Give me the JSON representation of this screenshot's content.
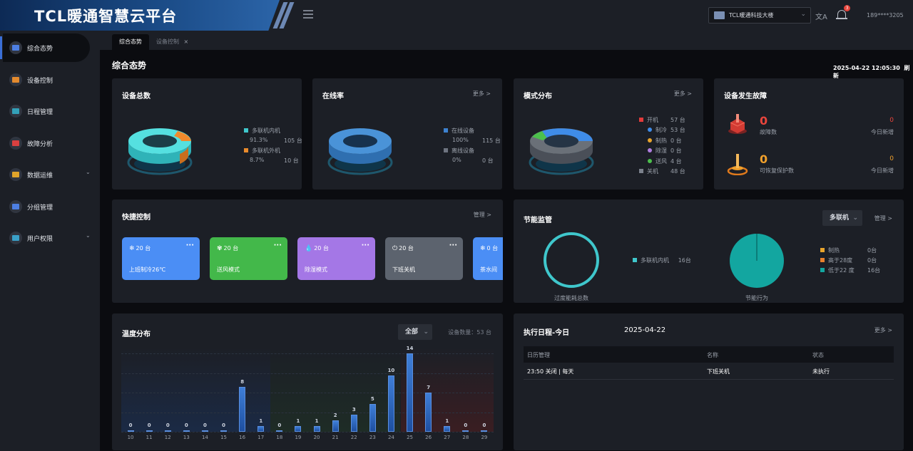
{
  "app": {
    "title": "TCL暖通智慧云平台",
    "building": "TCL暖通科技大楼",
    "notifications": "3",
    "user": "189****3205",
    "lang_icon": "translate-icon"
  },
  "sidebar": {
    "items": [
      {
        "label": "综合态势",
        "icon": "dashboard-icon",
        "color": "#4d7fe3"
      },
      {
        "label": "设备控制",
        "icon": "device-icon",
        "color": "#e38a2e"
      },
      {
        "label": "日程管理",
        "icon": "calendar-icon",
        "color": "#33a0b8"
      },
      {
        "label": "故障分析",
        "icon": "fault-icon",
        "color": "#d94040"
      },
      {
        "label": "数据运维",
        "icon": "data-icon",
        "color": "#e0a42a"
      },
      {
        "label": "分组管理",
        "icon": "group-icon",
        "color": "#4d7fe3"
      },
      {
        "label": "用户权限",
        "icon": "users-icon",
        "color": "#3aa0c8"
      }
    ]
  },
  "tabs": [
    {
      "label": "综合态势"
    },
    {
      "label": "设备控制",
      "close": "×"
    }
  ],
  "page": {
    "title": "综合态势",
    "datetime": "2025-04-22 12:05:30",
    "refresh": "刷新"
  },
  "device_total": {
    "title": "设备总数",
    "items": [
      {
        "label": "多联机内机",
        "pct": "91.3%",
        "count": "105 台",
        "color": "#3fc7cc"
      },
      {
        "label": "多联机外机",
        "pct": "8.7%",
        "count": "10 台",
        "color": "#e88a2c"
      }
    ]
  },
  "online": {
    "title": "在线率",
    "more": "更多 >",
    "items": [
      {
        "label": "在线设备",
        "pct": "100%",
        "count": "115 台",
        "color": "#3d82d0"
      },
      {
        "label": "离线设备",
        "pct": "0%",
        "count": "0 台",
        "color": "#6e7480"
      }
    ]
  },
  "mode": {
    "title": "模式分布",
    "more": "更多 >",
    "items": [
      {
        "label": "开机",
        "count": "57 台",
        "color": "#e23b3b",
        "square": true
      },
      {
        "label": "制冷",
        "count": "53 台",
        "color": "#3f8ce8"
      },
      {
        "label": "制热",
        "count": "0 台",
        "color": "#e8a42c"
      },
      {
        "label": "除湿",
        "count": "0 台",
        "color": "#b07ee0"
      },
      {
        "label": "送风",
        "count": "4 台",
        "color": "#4cc04c"
      },
      {
        "label": "关机",
        "count": "48 台",
        "color": "#7b818c",
        "square": true
      }
    ]
  },
  "fault": {
    "title": "设备发生故障",
    "rows": [
      {
        "value": "0",
        "label": "故障数",
        "today": "0",
        "today_label": "今日新增",
        "color": "#e8453c"
      },
      {
        "value": "0",
        "label": "可恢复保护数",
        "today": "0",
        "today_label": "今日新增",
        "color": "#f0a02c"
      }
    ]
  },
  "quick": {
    "title": "快捷控制",
    "manage": "管理 >",
    "items": [
      {
        "count": "20 台",
        "label": "上班制冷26℃",
        "color": "#4b8ef5",
        "icon": "snowflake-icon",
        "glyph": "❄"
      },
      {
        "count": "20 台",
        "label": "送风模式",
        "color": "#43b84a",
        "icon": "fan-icon",
        "glyph": "✾"
      },
      {
        "count": "20 台",
        "label": "除湿模式",
        "color": "#a477e6",
        "icon": "droplet-icon",
        "glyph": "💧"
      },
      {
        "count": "20 台",
        "label": "下班关机",
        "color": "#5c636e",
        "icon": "power-icon",
        "glyph": "⏻"
      },
      {
        "count": "0 台",
        "label": "茶水间",
        "color": "#4b8ef5",
        "icon": "snowflake-icon",
        "glyph": "❄"
      }
    ],
    "dots": "···"
  },
  "energy": {
    "title": "节能监管",
    "select": "多联机",
    "manage": "管理 >",
    "ring_label": "过度能耗总数",
    "pie_label": "节能行为",
    "ring_legend": {
      "label": "多联机内机",
      "count": "16台",
      "color": "#3fc7cc"
    },
    "pie_legend": [
      {
        "label": "制热",
        "count": "0台",
        "color": "#e8a42c"
      },
      {
        "label": "高于28度",
        "count": "0台",
        "color": "#e8802c"
      },
      {
        "label": "低于22 度",
        "count": "16台",
        "color": "#13a6a0"
      }
    ]
  },
  "temp": {
    "title": "温度分布",
    "select": "全部",
    "device_count": "设备数量：53 台"
  },
  "chart_data": {
    "type": "bar",
    "title": "温度分布",
    "categories": [
      "10",
      "11",
      "12",
      "13",
      "14",
      "15",
      "16",
      "17",
      "18",
      "19",
      "20",
      "21",
      "22",
      "23",
      "24",
      "25",
      "26",
      "27",
      "28",
      "29"
    ],
    "values": [
      0,
      0,
      0,
      0,
      0,
      0,
      8,
      1,
      0,
      1,
      1,
      2,
      3,
      5,
      10,
      14,
      7,
      1,
      0,
      0
    ],
    "ylim": [
      0,
      14
    ],
    "zones": [
      {
        "from": "10",
        "to": "17",
        "color": "#1b2a45"
      },
      {
        "from": "18",
        "to": "24",
        "color": "#1e2c26"
      },
      {
        "from": "25",
        "to": "29",
        "color": "#3a1e22"
      }
    ]
  },
  "schedule": {
    "title": "执行日程-今日",
    "date": "2025-04-22",
    "more": "更多 >",
    "headers": [
      "日历管理",
      "名称",
      "状态"
    ],
    "rows": [
      {
        "time": "23:50 关闭 | 每天",
        "name": "下班关机",
        "status": "未执行"
      }
    ]
  }
}
